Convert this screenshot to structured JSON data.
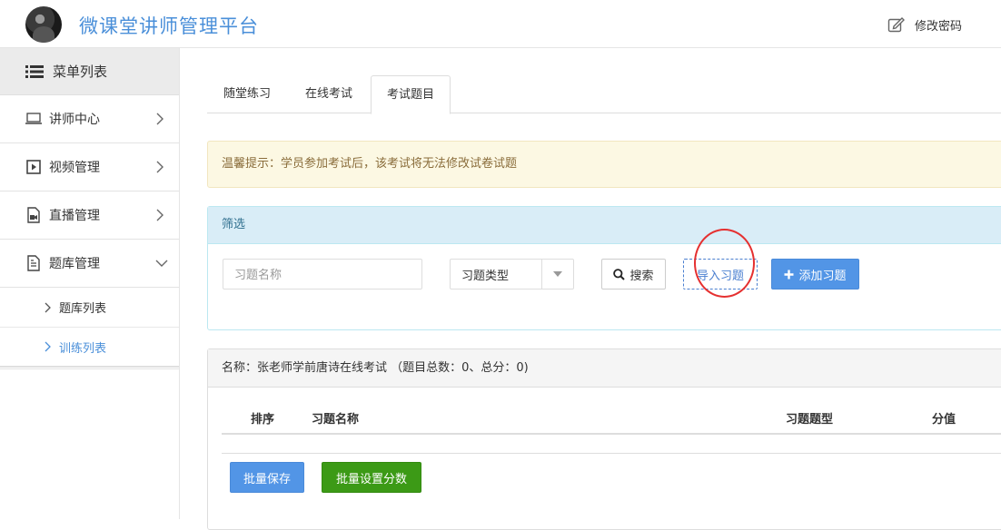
{
  "header": {
    "app_title": "微课堂讲师管理平台",
    "change_password": "修改密码"
  },
  "sidebar": {
    "menu_title": "菜单列表",
    "items": [
      {
        "label": "讲师中心",
        "icon": "laptop-icon"
      },
      {
        "label": "视频管理",
        "icon": "play-icon"
      },
      {
        "label": "直播管理",
        "icon": "live-icon"
      },
      {
        "label": "题库管理",
        "icon": "document-icon",
        "expanded": true
      }
    ],
    "sub_items": [
      {
        "label": "题库列表",
        "active": false
      },
      {
        "label": "训练列表",
        "active": true
      }
    ]
  },
  "tabs": [
    "随堂练习",
    "在线考试",
    "考试题目"
  ],
  "active_tab": "考试题目",
  "alert_text": "温馨提示：学员参加考试后，该考试将无法修改试卷试题",
  "filter": {
    "title": "筛选",
    "name_placeholder": "习题名称",
    "type_select": "习题类型",
    "search_button": "搜索",
    "import_button": "导入习题",
    "add_button": "添加习题"
  },
  "exam": {
    "header_text": "名称：张老师学前唐诗在线考试 （题目总数：0、总分：0)",
    "columns": [
      "排序",
      "习题名称",
      "习题题型",
      "分值"
    ],
    "batch_save": "批量保存",
    "batch_set_score": "批量设置分数"
  },
  "colors": {
    "brand_blue": "#4a8fd9",
    "primary_button": "#5295e6",
    "success_button": "#3c9a16",
    "highlight_circle": "#e53030"
  }
}
